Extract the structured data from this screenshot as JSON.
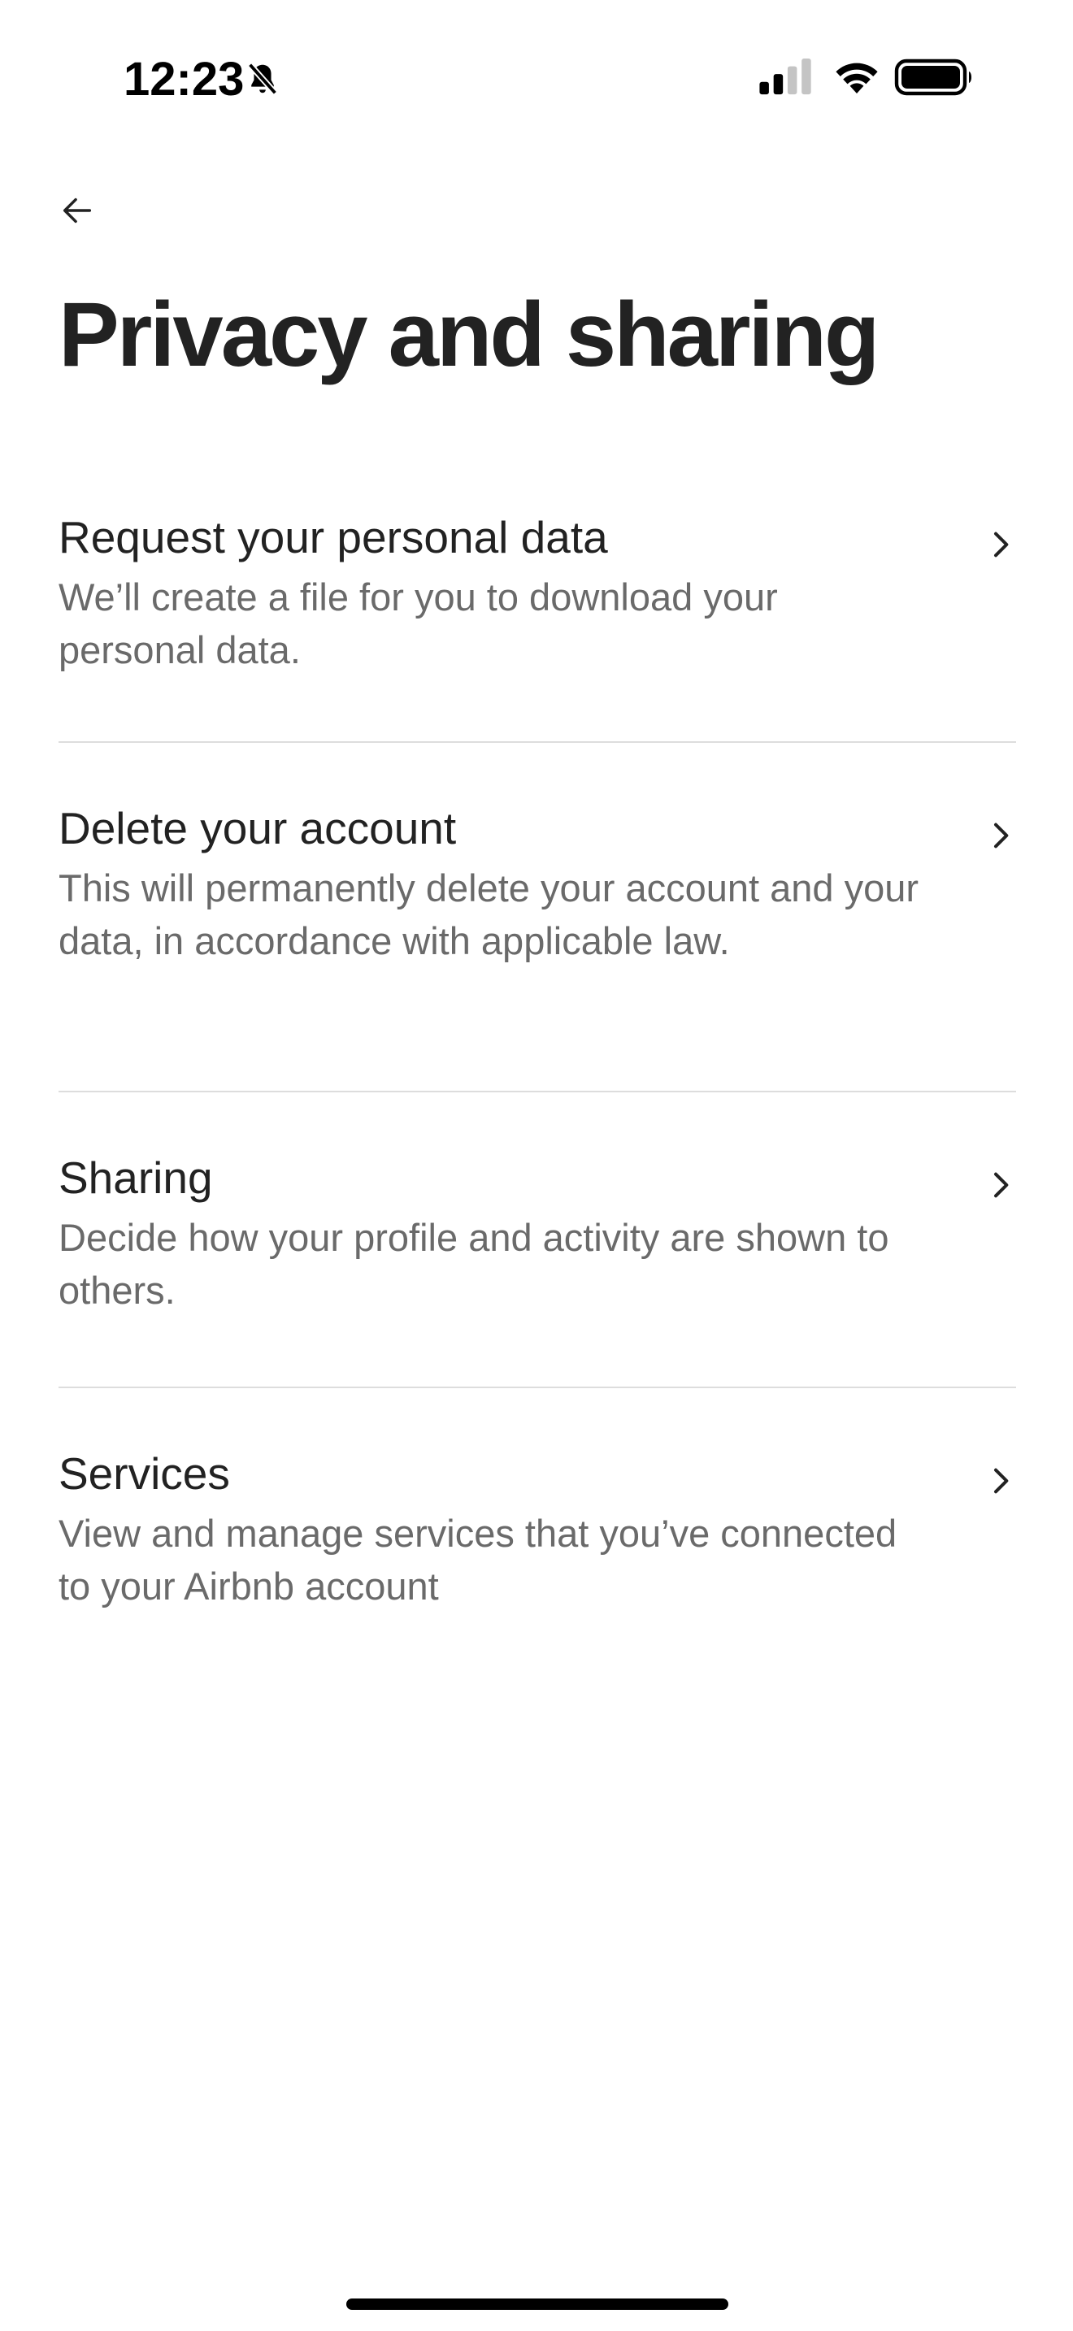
{
  "status_bar": {
    "time": "12:23"
  },
  "header": {
    "title": "Privacy and sharing"
  },
  "items": [
    {
      "title": "Request your personal data",
      "description": "We’ll create a file for you to download your personal data."
    },
    {
      "title": "Delete your account",
      "description": "This will permanently delete your account and your data, in accordance with applicable law."
    },
    {
      "title": "Sharing",
      "description": "Decide how your profile and activity are shown to others."
    },
    {
      "title": "Services",
      "description": "View and manage services that you’ve connected to your Airbnb account"
    }
  ],
  "icons": {
    "back": "arrow-left-icon",
    "chevron": "chevron-right-icon",
    "bell": "bell-slash-icon",
    "signal": "cellular-signal-icon",
    "wifi": "wifi-icon",
    "battery": "battery-icon"
  },
  "colors": {
    "title": "#222222",
    "description": "#6a6a6a",
    "divider": "#dddddd",
    "background": "#ffffff"
  }
}
